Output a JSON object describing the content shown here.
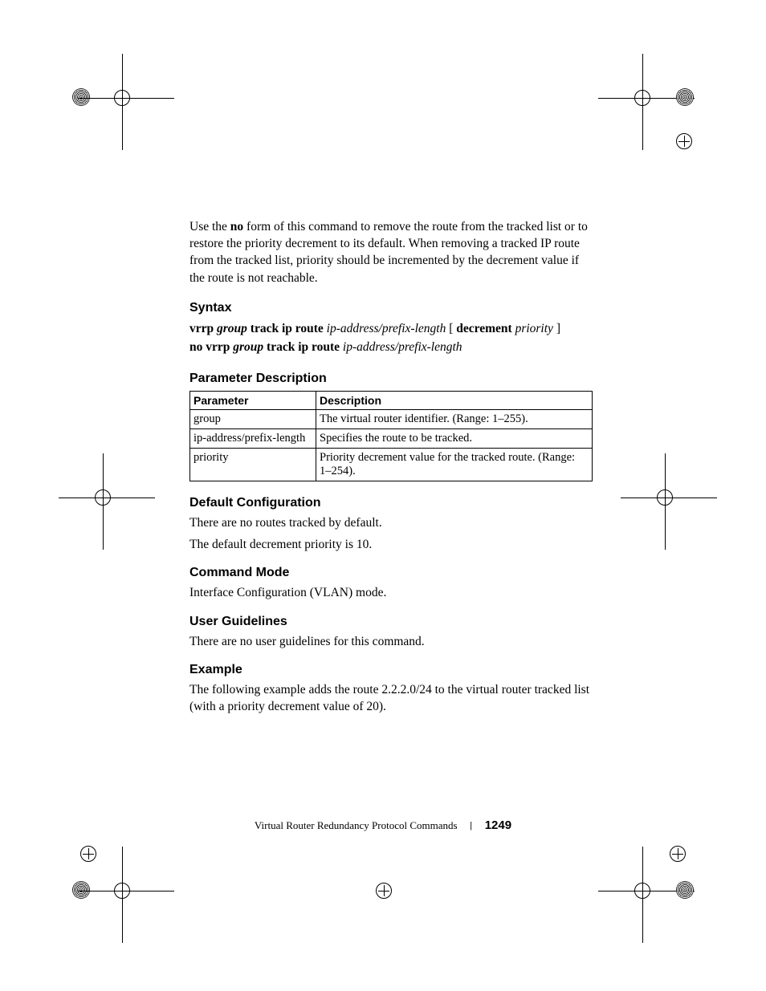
{
  "intro": {
    "pre": "Use the ",
    "no": "no",
    "post": " form of this command to remove the route from the tracked list or to restore the priority decrement to its default. When removing a tracked IP route from the tracked list, priority should be incremented by the decrement value if the route is not reachable."
  },
  "syntax": {
    "heading": "Syntax",
    "line1": {
      "a": "vrrp ",
      "b": "group",
      "c": " track ip route ",
      "d": "ip-address/prefix-length",
      "e": " [ ",
      "f": "decrement ",
      "g": "priority",
      "h": " ]"
    },
    "line2": {
      "a": "no vrrp ",
      "b": "group",
      "c": " track ip route ",
      "d": "ip-address/prefix-length"
    }
  },
  "param": {
    "heading": "Parameter Description",
    "col1": "Parameter",
    "col2": "Description",
    "rows": [
      {
        "p": "group",
        "d": "The virtual router identifier. (Range: 1–255)."
      },
      {
        "p": "ip-address/prefix-length",
        "d": "Specifies the route to be tracked."
      },
      {
        "p": "priority",
        "d": "Priority decrement value for the tracked route. (Range: 1–254)."
      }
    ]
  },
  "default": {
    "heading": "Default Configuration",
    "p1": "There are no routes tracked by default.",
    "p2": "The default decrement priority is 10."
  },
  "mode": {
    "heading": "Command Mode",
    "p1": "Interface Configuration (VLAN) mode."
  },
  "guidelines": {
    "heading": "User Guidelines",
    "p1": "There are no user guidelines for this command."
  },
  "example": {
    "heading": "Example",
    "p1": "The following example adds the route 2.2.2.0/24 to the virtual router tracked list (with a priority decrement value of 20)."
  },
  "footer": {
    "title": "Virtual Router Redundancy Protocol Commands",
    "page": "1249"
  }
}
